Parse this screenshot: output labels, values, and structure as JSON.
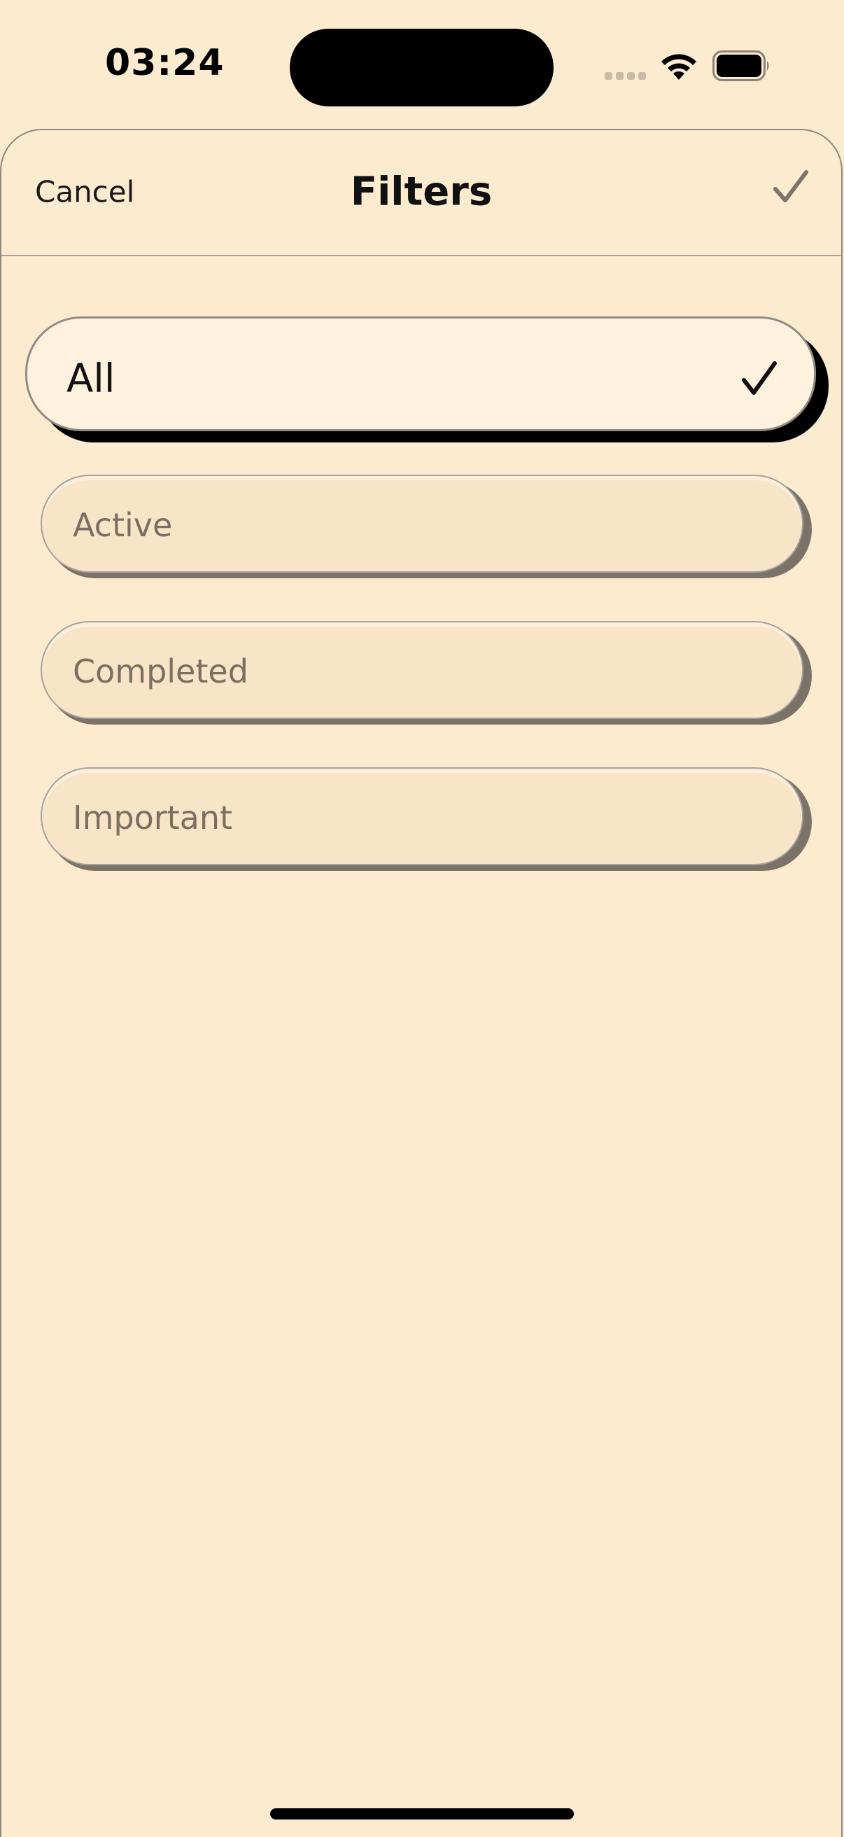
{
  "status_bar": {
    "time": "03:24",
    "wifi_icon": "wifi-icon",
    "battery_icon": "battery-icon",
    "signal_icon": "signal-dots-icon"
  },
  "sheet": {
    "cancel_label": "Cancel",
    "title": "Filters",
    "confirm_icon": "checkmark-icon"
  },
  "filters": {
    "selected": "All",
    "options": [
      {
        "label": "All",
        "selected": true
      },
      {
        "label": "Active",
        "selected": false
      },
      {
        "label": "Completed",
        "selected": false
      },
      {
        "label": "Important",
        "selected": false
      }
    ]
  },
  "colors": {
    "background": "#FDEBD0",
    "selected_pill": "#FEF1DD",
    "unselected_pill": "#F8E5C8",
    "unselected_text": "#7C6F61",
    "confirm_check": "#7C746B"
  }
}
